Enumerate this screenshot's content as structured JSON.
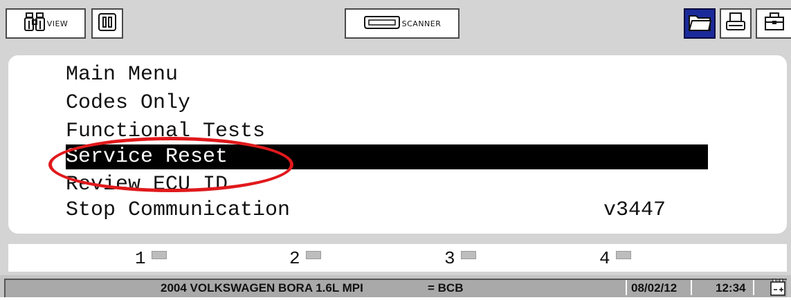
{
  "toolbar": {
    "view_label": "VIEW",
    "scanner_label": "SCANNER"
  },
  "menu": {
    "items": [
      {
        "label": "Main Menu"
      },
      {
        "label": "Codes Only"
      },
      {
        "label": "Functional Tests"
      },
      {
        "label": "Service Reset",
        "selected": true
      },
      {
        "label": "Review ECU ID"
      },
      {
        "label": "Stop Communication"
      }
    ],
    "version": "v3447"
  },
  "function_keys": [
    {
      "number": "1"
    },
    {
      "number": "2"
    },
    {
      "number": "3"
    },
    {
      "number": "4"
    }
  ],
  "status_bar": {
    "vehicle": "2004 VOLKSWAGEN  BORA 1.6L MPI",
    "code": "= BCB",
    "date": "08/02/12",
    "time": "12:34"
  },
  "colors": {
    "highlight_circle": "#e0191c",
    "selected_bg": "#000000",
    "active_folder_bg": "#1a2a9a"
  }
}
